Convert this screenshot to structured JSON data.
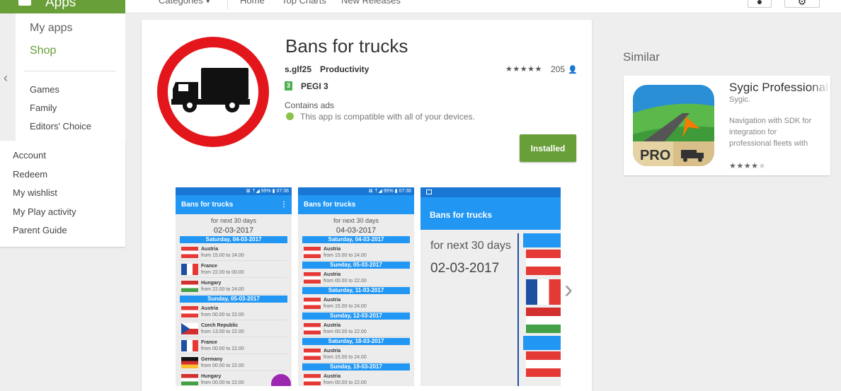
{
  "topbar": {
    "apps_label": "Apps",
    "nav": [
      "Categories ▾",
      "Home",
      "Top Charts",
      "New Releases"
    ]
  },
  "leftnav": {
    "primary": [
      "My apps",
      "Shop"
    ],
    "secondary": [
      "Games",
      "Family",
      "Editors' Choice"
    ],
    "account": [
      "Account",
      "Redeem",
      "My wishlist",
      "My Play activity",
      "Parent Guide"
    ]
  },
  "app": {
    "title": "Bans for trucks",
    "developer": "s.glf25",
    "category": "Productivity",
    "stars": "★★★★★",
    "rating_count": "205",
    "pegi_badge": "3",
    "pegi": "PEGI 3",
    "contains_ads": "Contains ads",
    "compatibility": "This app is compatible with all of your devices.",
    "install_button": "Installed"
  },
  "screenshots": [
    {
      "status": "⊠ ⇡◢ 95% ▮ 07:36",
      "title": "Bans for trucks",
      "menu": "⋮",
      "subtitle": "for next 30 days",
      "date": "02-03-2017",
      "days": [
        {
          "label": "Saturday, 04-03-2017",
          "entries": [
            {
              "flag": "austria",
              "country": "Austria",
              "time": "from 15.00 to 24.00"
            },
            {
              "flag": "france",
              "country": "France",
              "time": "from 22.00 to 00.00"
            },
            {
              "flag": "hungary",
              "country": "Hungary",
              "time": "from 22.00 to 24.00"
            }
          ]
        },
        {
          "label": "Sunday, 05-03-2017",
          "entries": [
            {
              "flag": "austria",
              "country": "Austria",
              "time": "from 00.00 to 22.00"
            },
            {
              "flag": "czech",
              "country": "Czech Republic",
              "time": "from 13.00 to 22.00"
            },
            {
              "flag": "france",
              "country": "France",
              "time": "from 00.00 to 22.00"
            },
            {
              "flag": "germany",
              "country": "Germany",
              "time": "from 00.00 to 22.00"
            },
            {
              "flag": "hungary",
              "country": "Hungary",
              "time": "from 00.00 to 22.00"
            }
          ]
        }
      ]
    },
    {
      "status": "⊠ ⇡◢ 95% ▮ 07:36",
      "title": "Bans for trucks",
      "subtitle": "for next 30 days",
      "date": "04-03-2017",
      "days": [
        {
          "label": "Saturday, 04-03-2017",
          "entries": [
            {
              "flag": "austria",
              "country": "Austria",
              "time": "from 15.00 to 24.00"
            }
          ]
        },
        {
          "label": "Sunday, 05-03-2017",
          "entries": [
            {
              "flag": "austria",
              "country": "Austria",
              "time": "from 00.00 to 22.00"
            }
          ]
        },
        {
          "label": "Saturday, 11-03-2017",
          "entries": [
            {
              "flag": "austria",
              "country": "Austria",
              "time": "from 15.00 to 24.00"
            }
          ]
        },
        {
          "label": "Sunday, 12-03-2017",
          "entries": [
            {
              "flag": "austria",
              "country": "Austria",
              "time": "from 00.00 to 22.00"
            }
          ]
        },
        {
          "label": "Saturday, 18-03-2017",
          "entries": [
            {
              "flag": "austria",
              "country": "Austria",
              "time": "from 15.00 to 24.00"
            }
          ]
        },
        {
          "label": "Sunday, 19-03-2017",
          "entries": [
            {
              "flag": "austria",
              "country": "Austria",
              "time": "from 00.00 to 22.00"
            }
          ]
        }
      ]
    },
    {
      "title": "Bans for trucks",
      "subtitle": "for next 30 days",
      "date": "02-03-2017"
    }
  ],
  "similar": {
    "heading": "Similar",
    "apps": [
      {
        "title": "Sygic Professional Navigation",
        "developer": "Sygic.",
        "description": "Navigation with SDK for integration for professional fleets with",
        "badge": "PRO",
        "stars_on": "★★★★",
        "stars_off": "★"
      }
    ]
  },
  "colors": {
    "brand_green": "#689f38",
    "accent_blue": "#2196f3",
    "ban_red": "#e3161b"
  }
}
